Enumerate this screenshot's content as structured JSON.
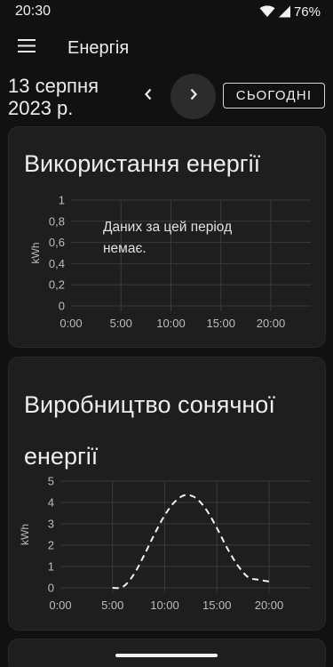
{
  "status_bar": {
    "time": "20:30",
    "battery": "76%",
    "icons": [
      "wifi-icon",
      "signal-icon"
    ]
  },
  "app_bar": {
    "title": "Енергія",
    "menu_icon": "menu-icon"
  },
  "date_nav": {
    "date_line1": "13 серпня",
    "date_line2": "2023 р.",
    "prev_icon": "chevron-left-icon",
    "next_icon": "chevron-right-icon",
    "today_label": "СЬОГОДНІ"
  },
  "usage_card": {
    "title": "Використання енергії",
    "no_data_text": "Даних за цей період немає.",
    "chart_data": {
      "type": "line",
      "title": "",
      "ylabel": "kWh",
      "xlabel": "",
      "ylim": [
        0,
        1
      ],
      "y_ticks": [
        "0",
        "0,2",
        "0,4",
        "0,6",
        "0,8",
        "1"
      ],
      "x_ticks": [
        "0:00",
        "5:00",
        "10:00",
        "15:00",
        "20:00"
      ],
      "xlim": [
        0,
        24
      ],
      "series": []
    }
  },
  "solar_card": {
    "title": "Виробництво сонячної енергії",
    "chart_data": {
      "type": "line",
      "title": "",
      "ylabel": "kWh",
      "xlabel": "",
      "ylim": [
        0,
        5
      ],
      "y_ticks": [
        "0",
        "1",
        "2",
        "3",
        "4",
        "5"
      ],
      "x_ticks": [
        "0:00",
        "5:00",
        "10:00",
        "15:00",
        "20:00"
      ],
      "xlim": [
        0,
        24
      ],
      "line_style": "dashed",
      "series": [
        {
          "x": [
            5,
            6,
            7,
            8,
            9,
            10,
            11,
            12,
            13,
            14,
            15,
            16,
            17,
            18,
            19,
            20
          ],
          "values": [
            0,
            0.05,
            0.6,
            1.5,
            2.5,
            3.4,
            4.05,
            4.35,
            4.2,
            3.65,
            2.8,
            1.85,
            1.05,
            0.5,
            0.38,
            0.3
          ]
        }
      ]
    }
  }
}
